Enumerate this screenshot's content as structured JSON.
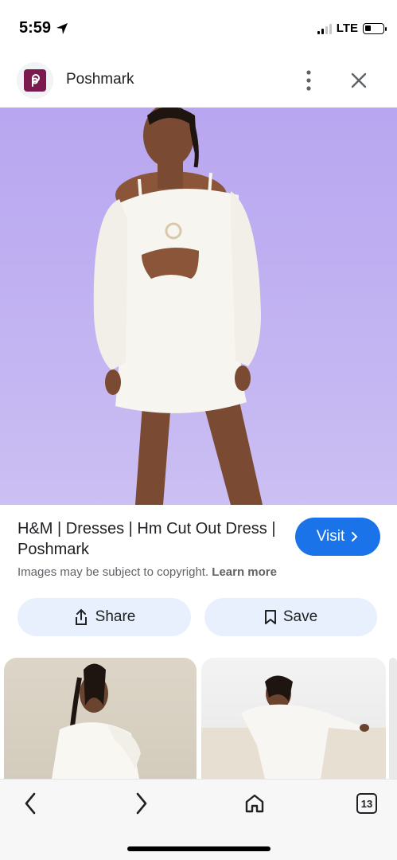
{
  "status_bar": {
    "time": "5:59",
    "network": "LTE",
    "signal_bars": 2,
    "battery_level": 0.35
  },
  "site": {
    "name": "Poshmark",
    "brand_color": "#7b1a4f"
  },
  "result": {
    "title": "H&M | Dresses | Hm Cut Out Dress | Poshmark",
    "visit_label": "Visit",
    "copyright_text": "Images may be subject to copyright.",
    "learn_more_label": "Learn more"
  },
  "actions": {
    "share_label": "Share",
    "save_label": "Save"
  },
  "bottom_nav": {
    "tab_count": "13"
  },
  "colors": {
    "accent": "#1a73e8",
    "action_bg": "#e8f0fe",
    "hero_bg": "#c2b3f2"
  },
  "icons": [
    "location-arrow-icon",
    "signal-icon",
    "battery-icon",
    "poshmark-logo-icon",
    "more-vert-icon",
    "close-icon",
    "chevron-right-icon",
    "share-icon",
    "bookmark-icon",
    "back-icon",
    "forward-icon",
    "home-icon",
    "tabs-icon"
  ]
}
